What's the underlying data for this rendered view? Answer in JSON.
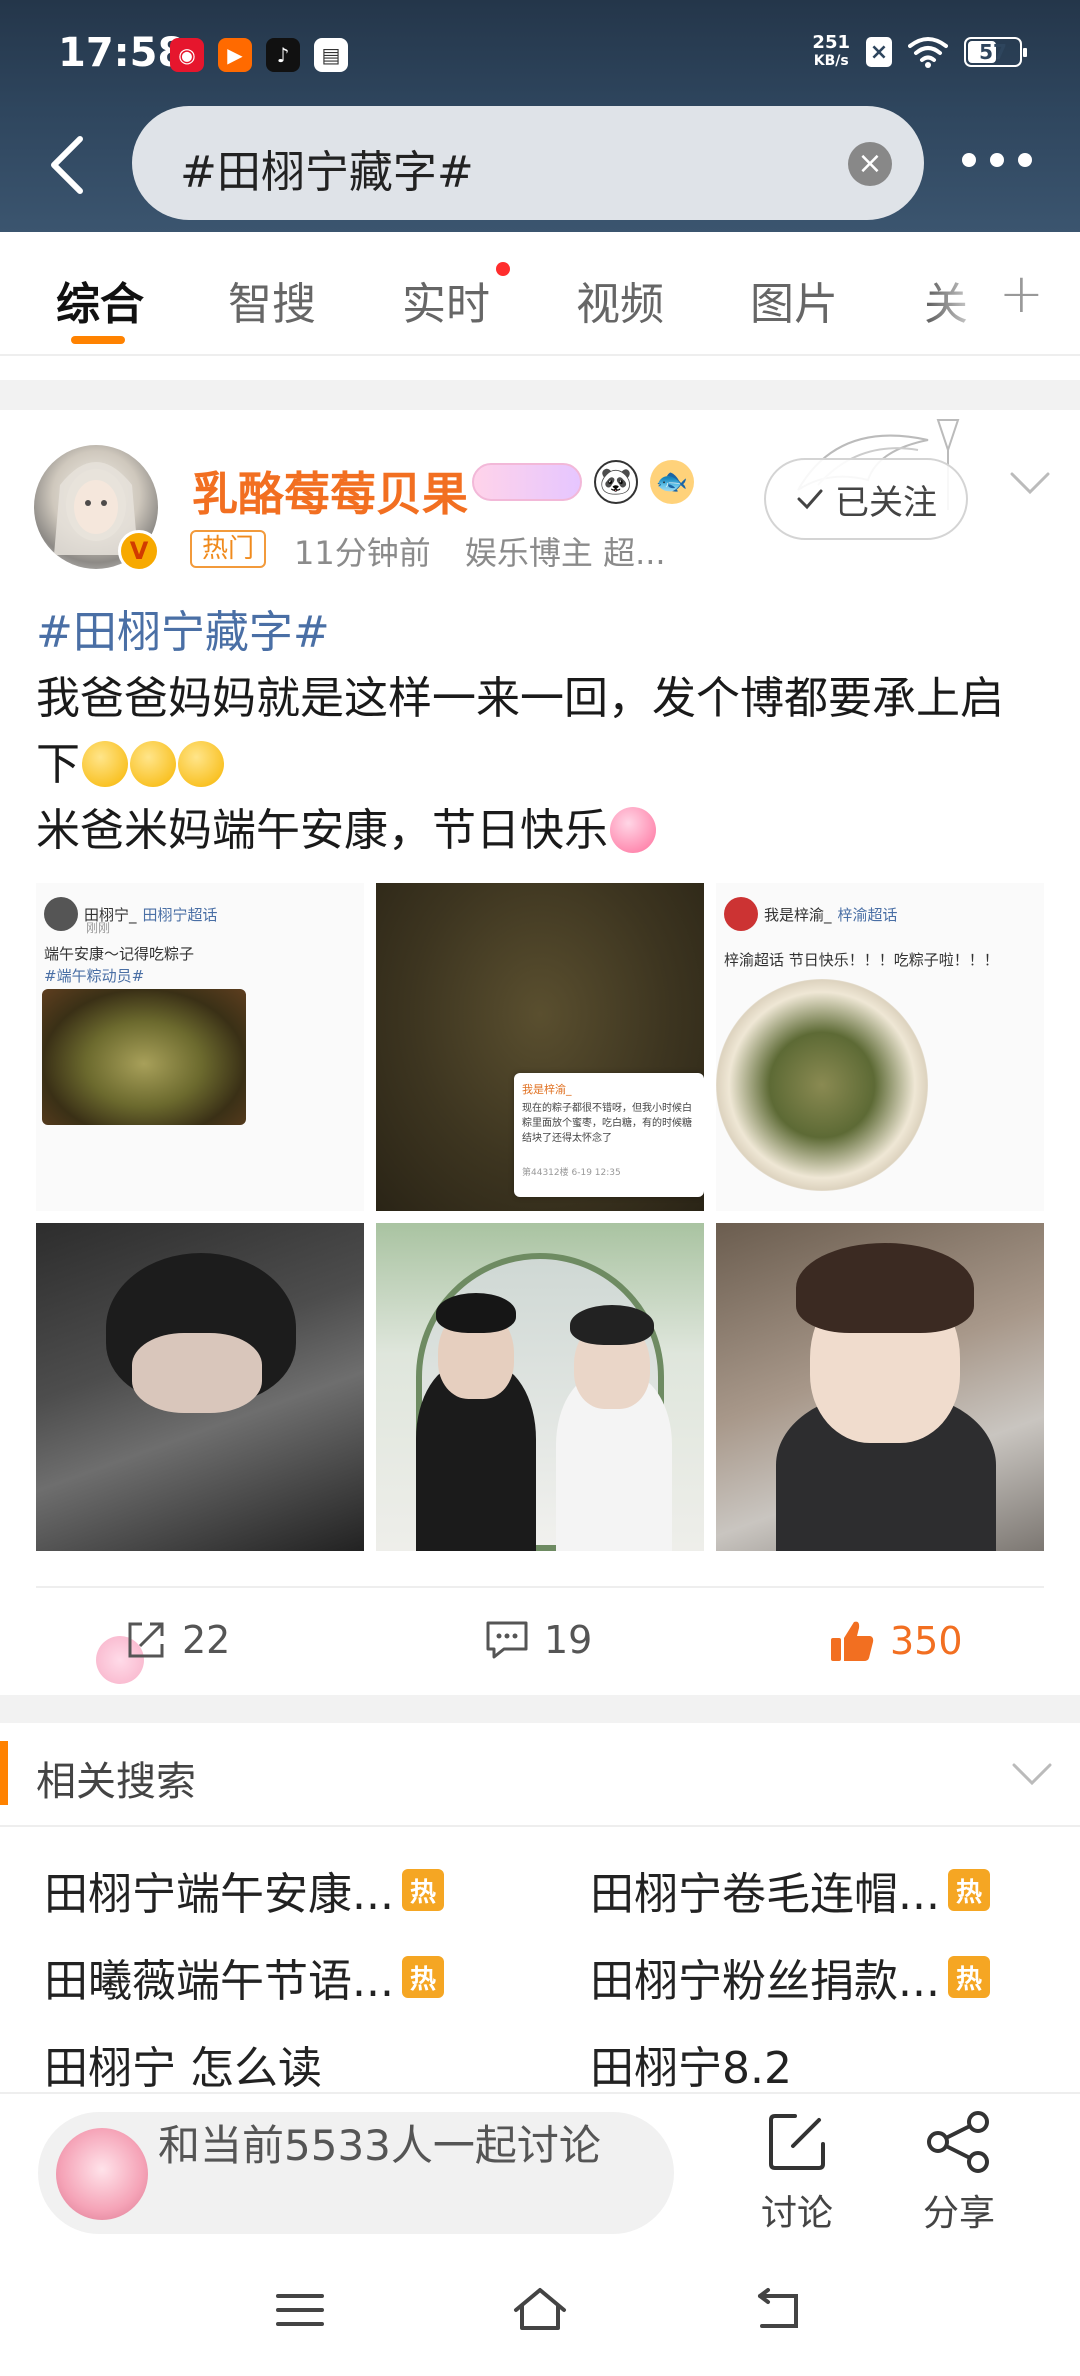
{
  "status_bar": {
    "time": "17:58",
    "net_speed_value": "251",
    "net_speed_unit": "KB/s",
    "battery": "57",
    "app_icons": [
      "weibo-icon",
      "video-app-icon",
      "music-app-icon",
      "wallet-app-icon"
    ]
  },
  "search": {
    "query": "#田栩宁藏字#"
  },
  "tabs": [
    {
      "label": "综合",
      "active": true
    },
    {
      "label": "智搜",
      "active": false
    },
    {
      "label": "实时",
      "active": false,
      "dot": true
    },
    {
      "label": "视频",
      "active": false
    },
    {
      "label": "图片",
      "active": false
    },
    {
      "label": "关",
      "active": false
    }
  ],
  "post": {
    "author": "乳酪莓莓贝果",
    "hot_tag": "热门",
    "time": "11分钟前",
    "source": "娱乐博主 超...",
    "follow_label": "已关注",
    "hashtag": "#田栩宁藏字#",
    "line1": "我爸爸妈妈就是这样一来一回，发个博都要承上启下",
    "line2": "米爸米妈端午安康，节日快乐",
    "images": {
      "img1": {
        "name": "田栩宁_",
        "circle": "田栩宁超话",
        "sub": "刚刚",
        "text1": "端午安康～记得吃粽子",
        "text2": "#端午粽动员#"
      },
      "img2": {
        "name": "我是梓渝_",
        "text": "现在的粽子都很不错呀，但我小时候白粽里面放个蜜枣，吃白糖，有的时候糖结块了还得太怀念了",
        "footer": "第44312楼 6-19 12:35"
      },
      "img3": {
        "name": "我是梓渝_",
        "circle": "梓渝超话",
        "text": "梓渝超话 节日快乐！！！吃粽子啦！！！"
      }
    },
    "repost_count": "22",
    "comment_count": "19",
    "like_count": "350"
  },
  "related": {
    "title": "相关搜索",
    "hot_label": "热",
    "items": [
      {
        "text": "田栩宁端午安康...",
        "hot": true
      },
      {
        "text": "田栩宁卷毛连帽...",
        "hot": true
      },
      {
        "text": "田曦薇端午节语...",
        "hot": true
      },
      {
        "text": "田栩宁粉丝捐款...",
        "hot": true
      },
      {
        "text": "田栩宁 怎么读",
        "hot": false
      },
      {
        "text": "田栩宁8.2",
        "hot": false
      }
    ]
  },
  "bottom": {
    "discuss_text": "和当前5533人一起讨论",
    "discuss_btn": "讨论",
    "share_btn": "分享"
  },
  "colors": {
    "accent": "#ff8200",
    "author": "#f26f21",
    "hashtag": "#4a6fa5",
    "like": "#f26f21",
    "hot_badge": "#f5a623"
  }
}
